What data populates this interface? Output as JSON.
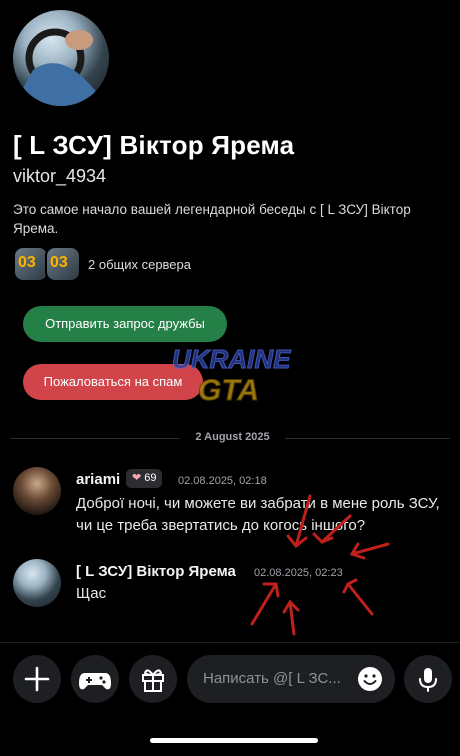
{
  "profile": {
    "display_name": "[ L  ЗСУ] Віктор Ярема",
    "username": "viktor_4934",
    "intro": "Это самое начало вашей легендарной беседы с [ L  ЗСУ] Віктор Ярема.",
    "mutual_servers": "2 общих сервера",
    "server_icon_text": "03"
  },
  "actions": {
    "friend_request": "Отправить запрос дружбы",
    "report_spam": "Пожаловаться на спам"
  },
  "watermark": {
    "line1": "UKRAINE",
    "line2": "GTA"
  },
  "chat": {
    "date_divider": "2 August 2025",
    "messages": [
      {
        "author": "ariami",
        "badge_count": "69",
        "timestamp": "02.08.2025, 02:18",
        "text": "Доброї ночі, чи можете ви забрати в мене роль ЗСУ, чи це треба звертатись до когось іншого?"
      },
      {
        "author": "[ L  ЗСУ] Віктор Ярема",
        "timestamp": "02.08.2025, 02:23",
        "text": "Щас"
      }
    ]
  },
  "composer": {
    "placeholder": "Написать @[ L  ЗС..."
  },
  "colors": {
    "background": "#000000",
    "friend_button": "#248046",
    "spam_button": "#d1454a",
    "annotation_arrows": "#c0201c"
  }
}
